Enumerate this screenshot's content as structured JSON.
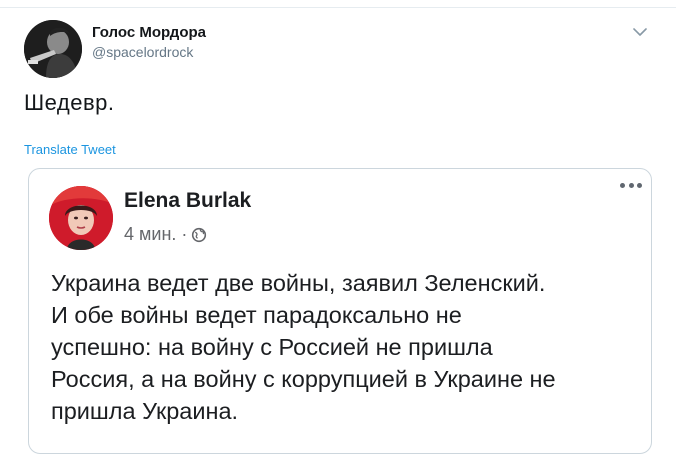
{
  "tweet": {
    "author": {
      "display_name": "Голос Мордора",
      "handle": "@spacelordrock"
    },
    "text": "Шедевр.",
    "translate_label": "Translate Tweet",
    "menu_icon": "chevron-down-icon"
  },
  "embedded_post": {
    "author_name": "Elena Burlak",
    "time_label": "4 мин.",
    "separator": "·",
    "audience_icon": "globe-icon",
    "more_icon": "more-dots-icon",
    "body_lines": [
      "Украина ведет две войны, заявил Зеленский.",
      "И обе войны ведет парадоксально не",
      "успешно: на войну с Россией не пришла",
      "Россия, а на войну с коррупцией в Украине не",
      "пришла Украина."
    ]
  },
  "colors": {
    "link": "#1b95e0",
    "secondary_text": "#657786",
    "border": "#ccd6dd",
    "fb_avatar_bg": "#d11a2a"
  }
}
